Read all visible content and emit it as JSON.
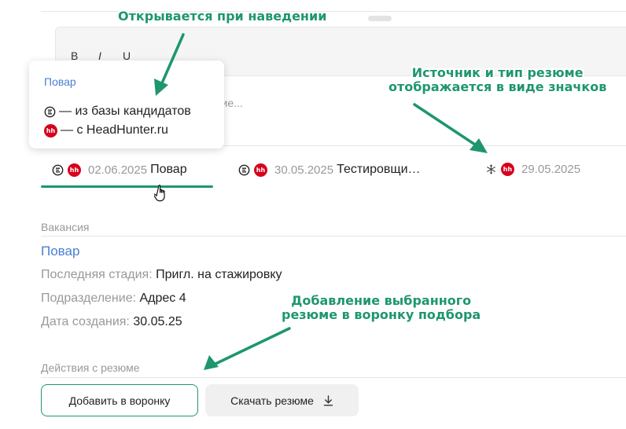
{
  "editor": {
    "bold_label": "B",
    "italic_label": "I",
    "underline_label": "U",
    "placeholder_fragment": "ение..."
  },
  "tooltip": {
    "title": "Повар",
    "rows": [
      {
        "icon": "source-base-icon",
        "text": "— из базы кандидатов"
      },
      {
        "icon": "hh-logo-icon",
        "text": "— с HeadHunter.ru"
      }
    ]
  },
  "resume_tabs": [
    {
      "icons": [
        "source-base-icon",
        "hh-logo-icon"
      ],
      "date": "02.06.2025",
      "name": "Повар",
      "selected": true
    },
    {
      "icons": [
        "source-base-icon",
        "hh-logo-icon"
      ],
      "date": "30.05.2025",
      "name": "Тестировщи…",
      "selected": false
    },
    {
      "icons": [
        "snowflake-icon",
        "hh-logo-icon"
      ],
      "date": "29.05.2025",
      "name": "",
      "selected": false
    }
  ],
  "hh_icon_text": "hh",
  "vacancy": {
    "section_label": "Вакансия",
    "title": "Повар",
    "last_stage_key": "Последняя стадия:",
    "last_stage_value": "Пригл. на стажировку",
    "department_key": "Подразделение:",
    "department_value": "Адрес 4",
    "created_key": "Дата создания:",
    "created_value": "30.05.25"
  },
  "actions": {
    "section_label": "Действия с резюме",
    "add_label": "Добавить в воронку",
    "download_label": "Скачать резюме"
  },
  "annotations": {
    "hover": "Открывается при наведении",
    "source_line1": "Источник и тип резюме",
    "source_line2": "отображается в виде значков",
    "add_line1": "Добавление выбранного",
    "add_line2": "резюме в воронку подбора"
  },
  "colors": {
    "accent": "#1e9670",
    "link": "#4a7fd1",
    "hh_red": "#d6001c",
    "muted": "#999999"
  }
}
